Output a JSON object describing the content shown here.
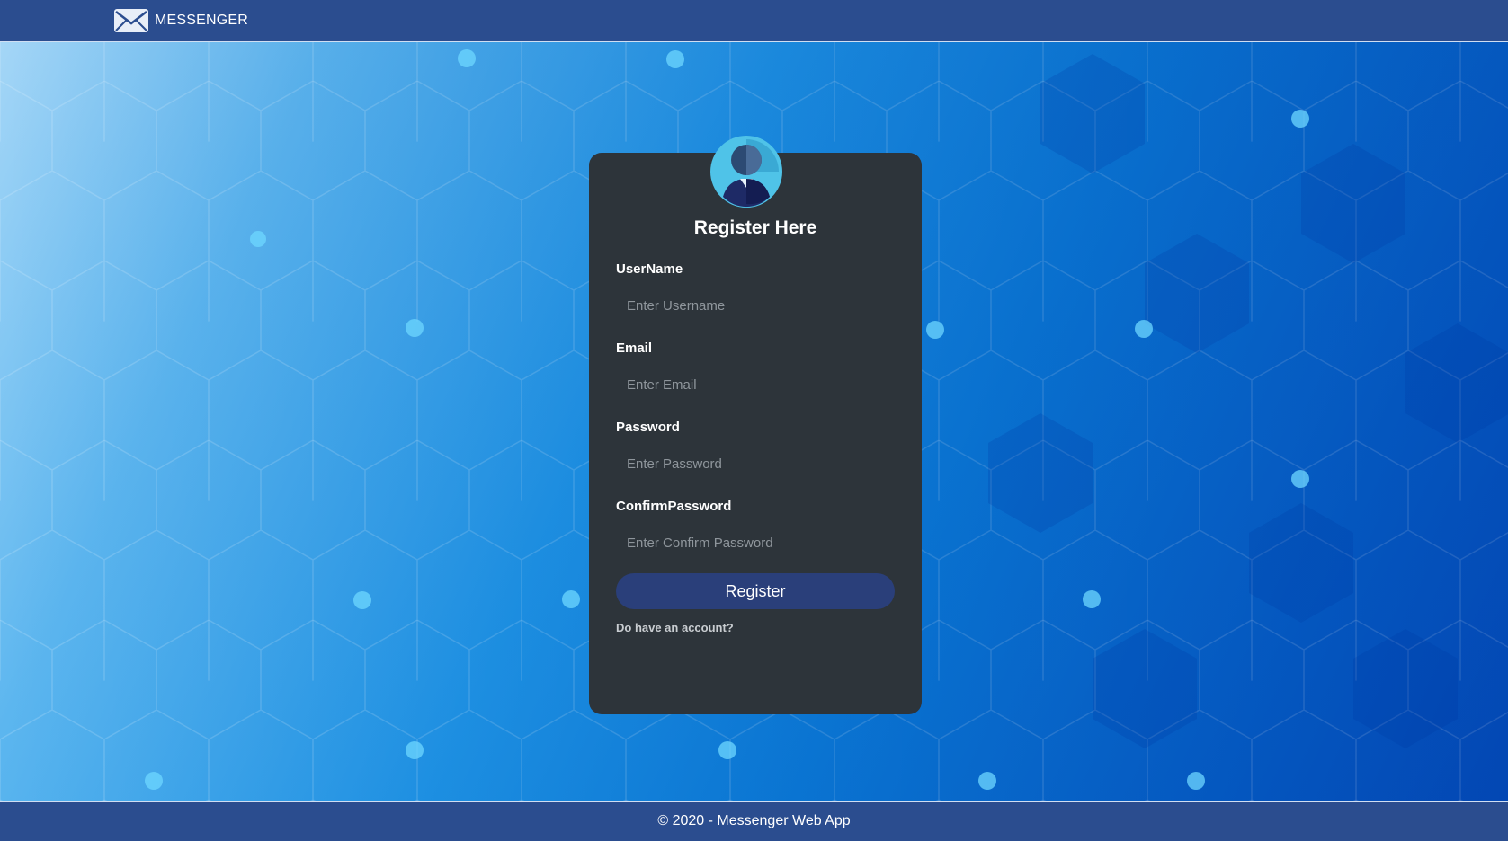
{
  "navbar": {
    "brand_text": "MESSENGER",
    "brand_icon": "envelope-icon"
  },
  "form": {
    "avatar_icon": "user-avatar-icon",
    "title": "Register Here",
    "fields": {
      "username": {
        "label": "UserName",
        "placeholder": "Enter Username"
      },
      "email": {
        "label": "Email",
        "placeholder": "Enter Email"
      },
      "password": {
        "label": "Password",
        "placeholder": "Enter Password"
      },
      "confirm": {
        "label": "ConfirmPassword",
        "placeholder": "Enter Confirm Password"
      }
    },
    "submit_label": "Register",
    "account_link": "Do have an account?"
  },
  "footer": {
    "text": "© 2020 - Messenger Web App"
  },
  "colors": {
    "navbar": "#2b4d8f",
    "card": "#2d343a",
    "button": "#2a3f7a",
    "avatar": "#4fc3e8"
  }
}
